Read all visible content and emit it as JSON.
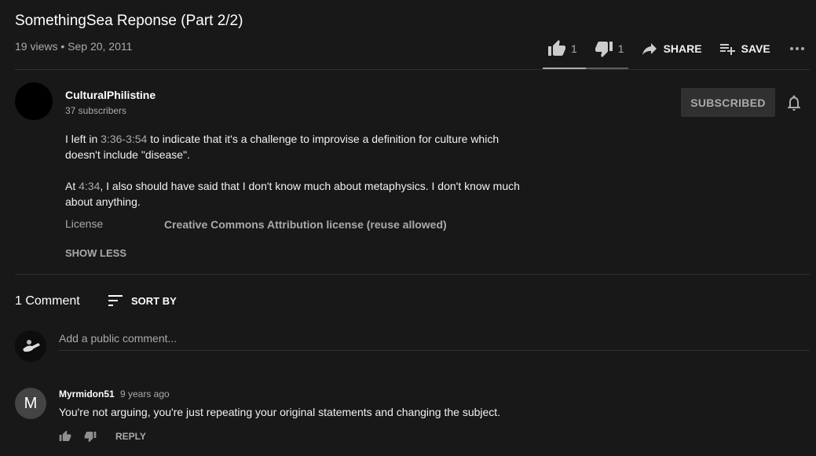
{
  "video": {
    "title": "SomethingSea Reponse (Part 2/2)",
    "views": "19 views",
    "separator": "•",
    "date": "Sep 20, 2011"
  },
  "actions": {
    "likes": "1",
    "dislikes": "1",
    "share_label": "SHARE",
    "save_label": "SAVE",
    "like_ratio": 0.5
  },
  "channel": {
    "name": "CulturalPhilistine",
    "subscribers": "37 subscribers",
    "subscribe_label": "SUBSCRIBED"
  },
  "description": {
    "p1_pre": "I left in ",
    "p1_ts1": "3:36",
    "p1_dash": "-",
    "p1_ts2": "3:54",
    "p1_post": " to indicate that it's a challenge to improvise a definition for culture which doesn't include \"disease\".",
    "p2_pre": "At ",
    "p2_ts": "4:34",
    "p2_post": ", I also should have said that I don't know much about metaphysics. I don't know much about anything.",
    "license_label": "License",
    "license_value": "Creative Commons Attribution license (reuse allowed)",
    "show_less": "SHOW LESS"
  },
  "comments": {
    "count_label": "1 Comment",
    "sort_label": "SORT BY",
    "input_placeholder": "Add a public comment...",
    "items": [
      {
        "avatar_letter": "M",
        "author": "Myrmidon51",
        "time": "9 years ago",
        "text": "You're not arguing, you're just repeating your original statements and changing the subject.",
        "reply_label": "REPLY"
      }
    ]
  },
  "colors": {
    "background": "#181818",
    "muted_text": "#aaaaaa",
    "divider": "#303030"
  }
}
